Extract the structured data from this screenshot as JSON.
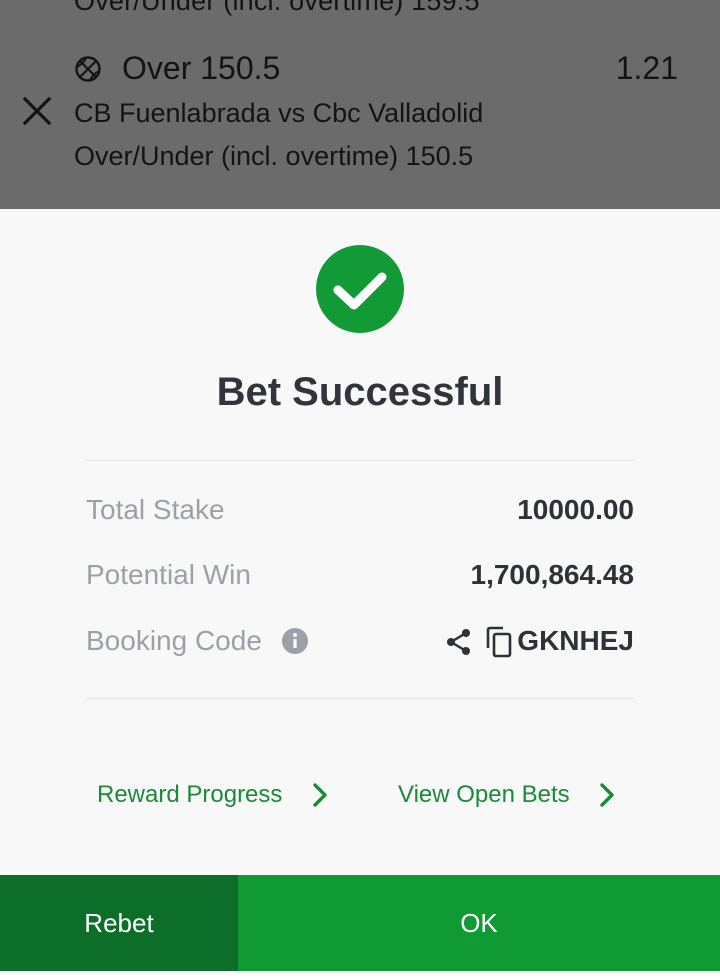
{
  "betslip": {
    "previous_market_partial": "Over/Under (incl. overtime) 159.5",
    "selection": {
      "icon": "basketball-icon",
      "name": "Over 150.5",
      "odds": "1.21",
      "match": "CB Fuenlabrada vs Cbc Valladolid",
      "market": "Over/Under (incl. overtime) 150.5"
    }
  },
  "success": {
    "icon": "check-circle-icon",
    "title": "Bet Successful",
    "rows": [
      {
        "label": "Total Stake",
        "value": "10000.00"
      },
      {
        "label": "Potential Win",
        "value": "1,700,864.48"
      },
      {
        "label": "Booking Code",
        "value": "GKNHEJ"
      }
    ],
    "links": {
      "reward_progress": "Reward Progress",
      "view_open_bets": "View Open Bets"
    }
  },
  "actions": {
    "rebet": "Rebet",
    "ok": "OK"
  },
  "colors": {
    "brand_green": "#0f9a34",
    "dark_green": "#0c6e28",
    "link_green": "#1a8a3a",
    "overlay": "#6b6b6b"
  }
}
